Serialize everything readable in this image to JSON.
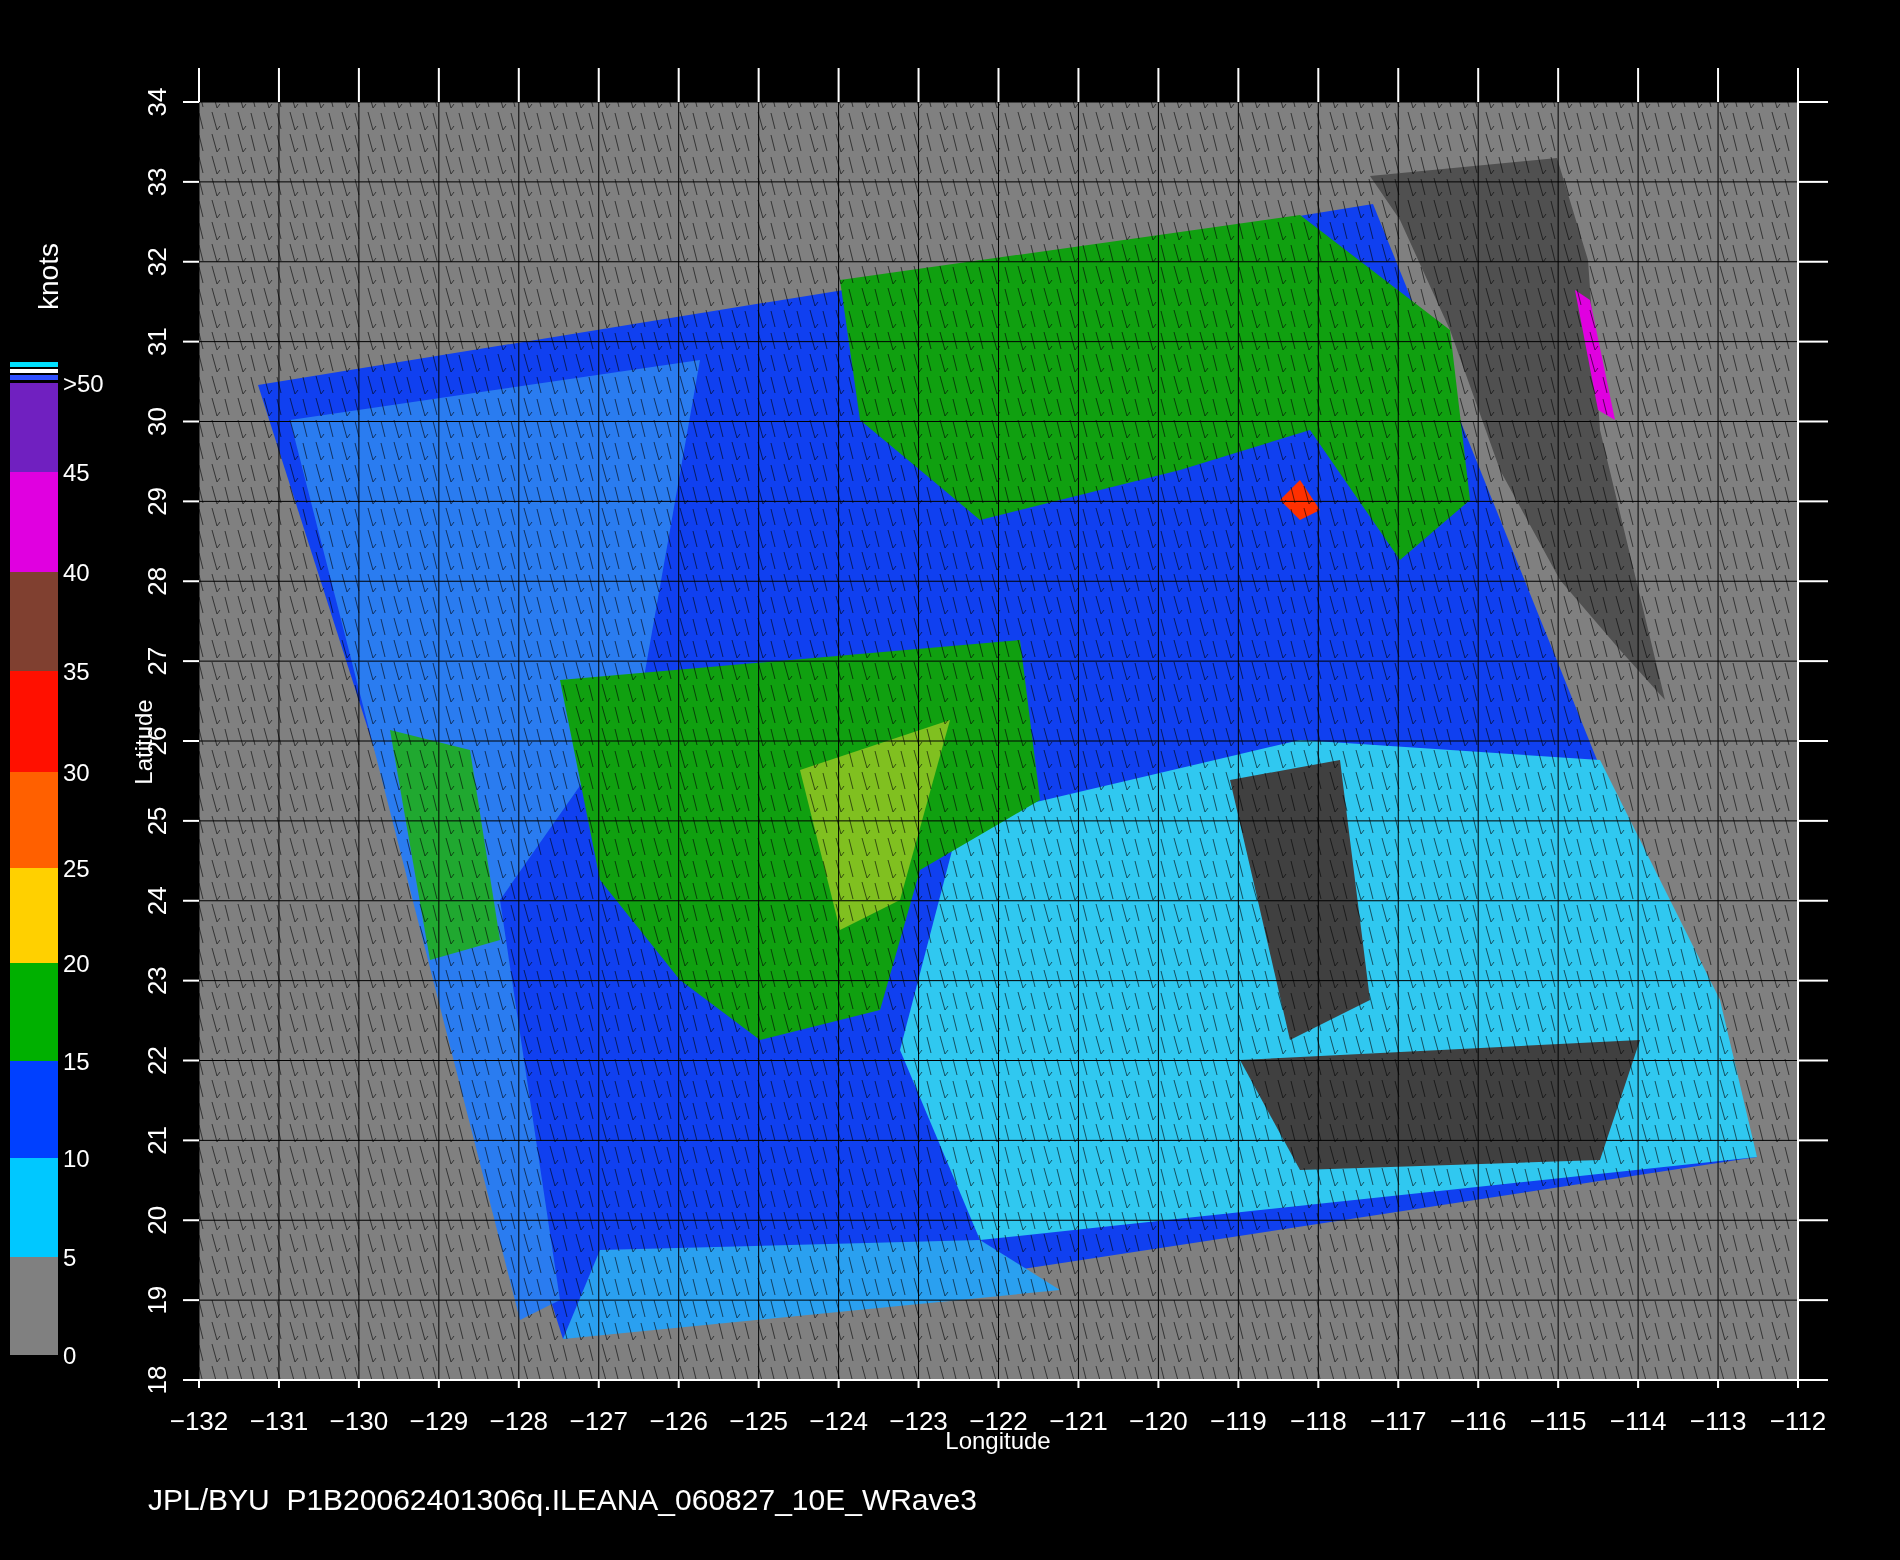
{
  "map": {
    "xlabel": "Longitude",
    "ylabel": "Latitude",
    "xtick_labels": [
      "−132",
      "−131",
      "−130",
      "−129",
      "−128",
      "−127",
      "−126",
      "−125",
      "−124",
      "−123",
      "−122",
      "−121",
      "−120",
      "−119",
      "−118",
      "−117",
      "−116",
      "−115",
      "−114",
      "−113",
      "−112"
    ],
    "ytick_labels": [
      "18",
      "19",
      "20",
      "21",
      "22",
      "23",
      "24",
      "25",
      "26",
      "27",
      "28",
      "29",
      "30",
      "31",
      "32",
      "33",
      "34"
    ]
  },
  "colorbar": {
    "title": "knots",
    "labels": [
      ">50",
      "45",
      "40",
      "35",
      "30",
      "25",
      "20",
      "15",
      "10",
      "5",
      "0"
    ],
    "bands": [
      {
        "color": "#7020c0"
      },
      {
        "color": "#e000e0"
      },
      {
        "color": "#804030"
      },
      {
        "color": "#ff1000"
      },
      {
        "color": "#ff6000"
      },
      {
        "color": "#ffd000"
      },
      {
        "color": "#00b000"
      },
      {
        "color": "#0040ff"
      },
      {
        "color": "#00c8ff"
      },
      {
        "color": "#808080"
      }
    ]
  },
  "footer": "JPL/BYU  P1B20062401306q.ILEANA_060827_10E_WRave3"
}
